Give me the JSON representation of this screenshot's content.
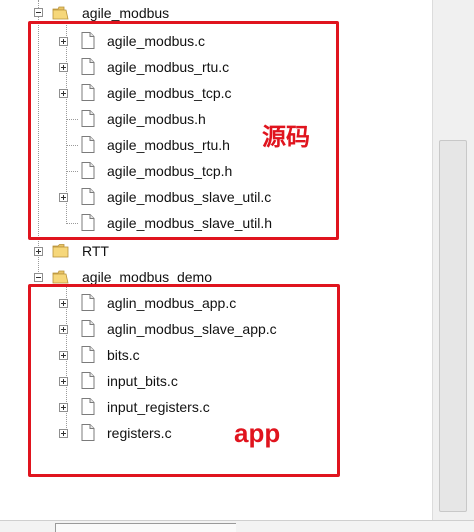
{
  "tree": {
    "agile_modbus_folder": "agile_modbus",
    "source_files": [
      "agile_modbus.c",
      "agile_modbus_rtu.c",
      "agile_modbus_tcp.c",
      "agile_modbus.h",
      "agile_modbus_rtu.h",
      "agile_modbus_tcp.h",
      "agile_modbus_slave_util.c",
      "agile_modbus_slave_util.h"
    ],
    "rtt_folder": "RTT",
    "demo_folder": "agile_modbus_demo",
    "app_files": [
      "aglin_modbus_app.c",
      "aglin_modbus_slave_app.c",
      "bits.c",
      "input_bits.c",
      "input_registers.c",
      "registers.c"
    ]
  },
  "annotations": {
    "source_label": "源码",
    "app_label": "app",
    "color": "#e0141e"
  },
  "icons": {
    "file": "file-icon",
    "folder": "folder-icon",
    "expand": "expand-icon",
    "collapse": "collapse-icon"
  }
}
